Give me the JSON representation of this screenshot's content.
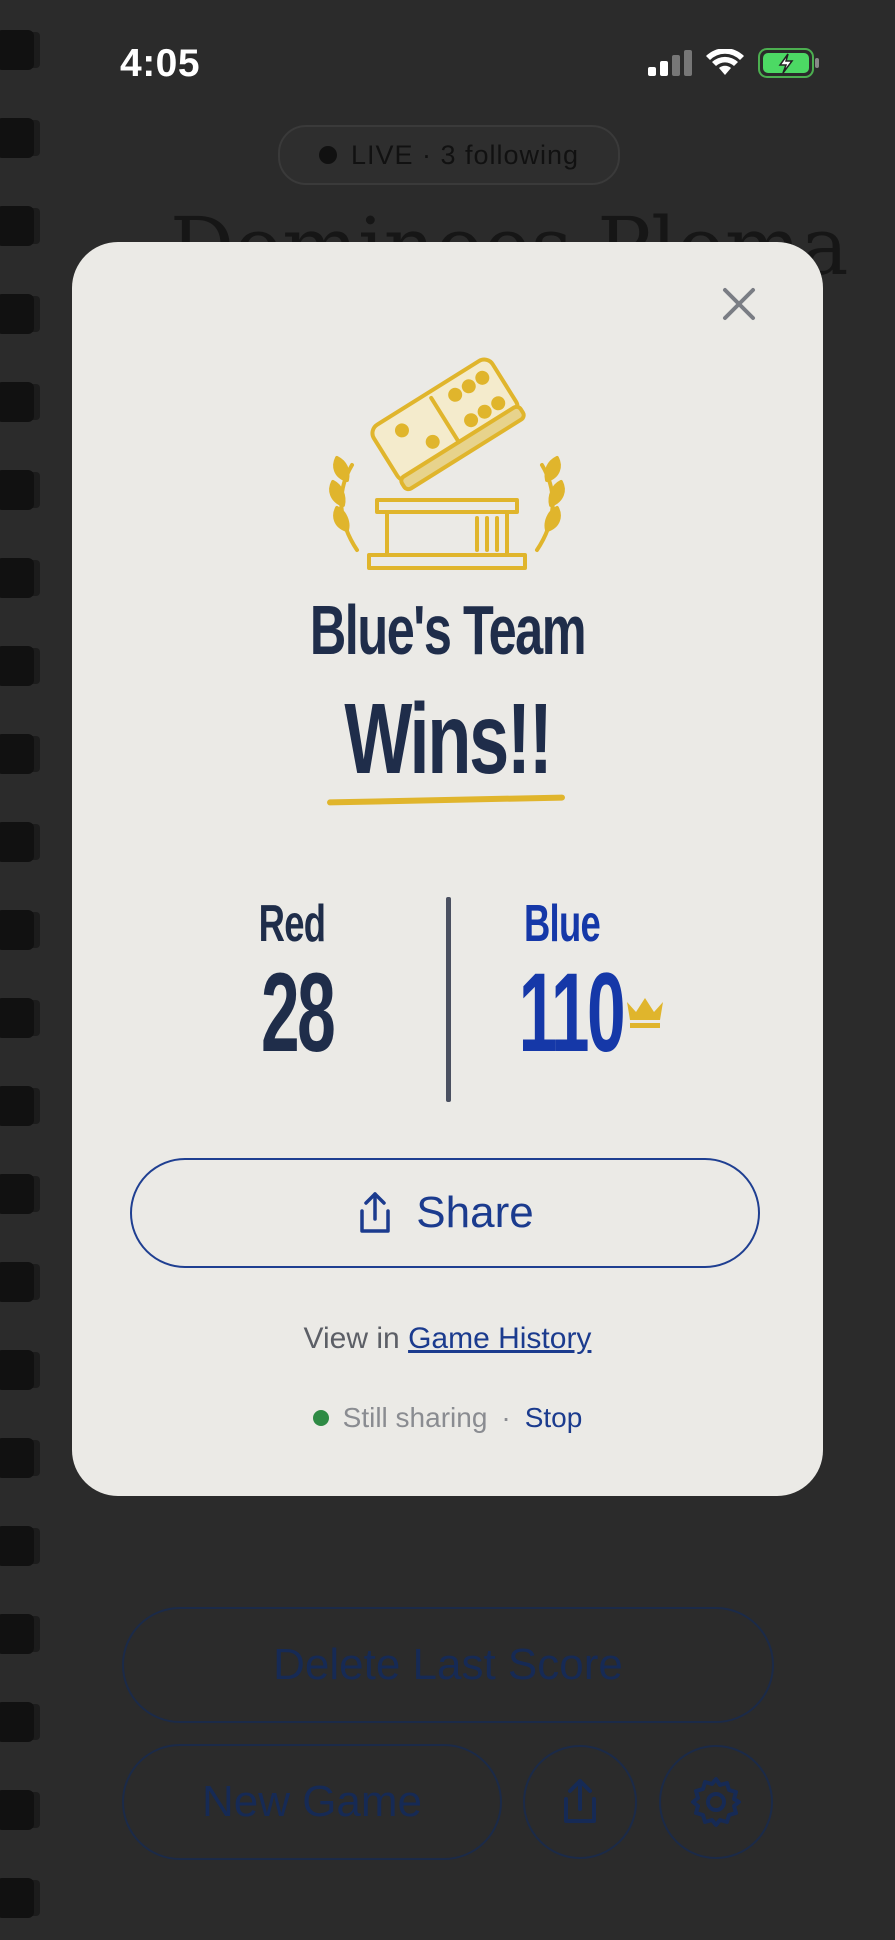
{
  "status_bar": {
    "time": "4:05",
    "icons": [
      "signal-icon",
      "wifi-icon",
      "battery-charging-icon"
    ]
  },
  "background": {
    "live_pill": "LIVE · 3 following",
    "title": "Dominoes Ploma",
    "delete_button": "Delete Last Score",
    "new_game_button": "New Game",
    "share_icon": "share-icon",
    "settings_icon": "gear-icon"
  },
  "modal": {
    "close_icon": "close-icon",
    "trophy_icon": "domino-trophy-icon",
    "headline_line1": "Blue's Team",
    "headline_line2": "Wins!!",
    "teams": [
      {
        "name": "Red",
        "score": "28",
        "color": "#1f2d4a"
      },
      {
        "name": "Blue",
        "score": "110",
        "color": "#1538a8",
        "winner": true
      }
    ],
    "crown_icon": "crown-icon",
    "share_label": "Share",
    "history_prefix": "View in",
    "history_link": "Game History",
    "sharing_status": "Still sharing",
    "separator": "·",
    "stop_label": "Stop"
  },
  "colors": {
    "accent": "#1b3b8e",
    "gold": "#e0b52c",
    "modal_bg": "#ebeae6",
    "status_green": "#2e8a44"
  }
}
